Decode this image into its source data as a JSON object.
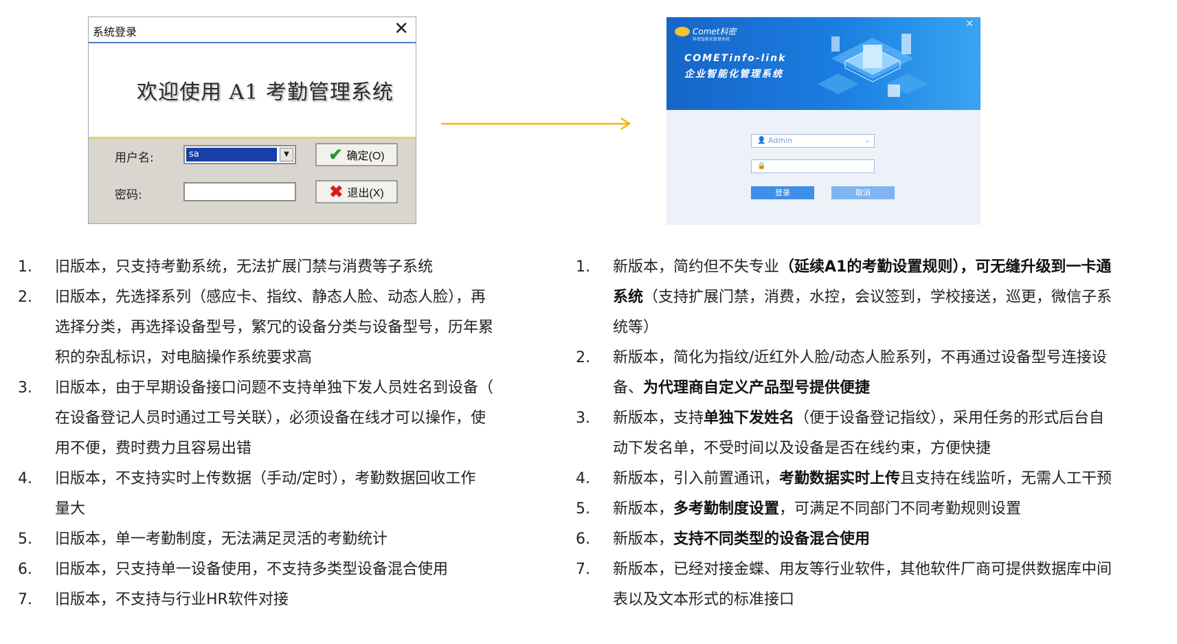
{
  "old_login": {
    "title": "系统登录",
    "close": "✕",
    "banner": "欢迎使用 A1 考勤管理系统",
    "username_label": "用户名:",
    "username_value": "sa",
    "password_label": "密码:",
    "ok_label": "确定(O)",
    "exit_label": "退出(X)"
  },
  "new_login": {
    "logo": "Comet科密",
    "logo_sub": "科密智能化管理系统",
    "brand": "COMETinfo-link",
    "subtitle": "企业智能化管理系统",
    "close": "✕",
    "username_value": "Admin",
    "login_label": "登录",
    "cancel_label": "取消"
  },
  "old_list": [
    {
      "num": "1.",
      "lines": [
        "旧版本，只支持考勤系统，无法扩展门禁与消费等子系统"
      ]
    },
    {
      "num": "2.",
      "lines": [
        "旧版本，先选择系列（感应卡、指纹、静态人脸、动态人脸），再",
        "选择分类，再选择设备型号，繁冗的设备分类与设备型号，历年累",
        "积的杂乱标识，对电脑操作系统要求高"
      ]
    },
    {
      "num": "3.",
      "lines": [
        "旧版本，由于早期设备接口问题不支持单独下发人员姓名到设备（",
        "在设备登记人员时通过工号关联），必须设备在线才可以操作，使",
        "用不便，费时费力且容易出错"
      ]
    },
    {
      "num": "4.",
      "lines": [
        "旧版本，不支持实时上传数据（手动/定时），考勤数据回收工作",
        "量大"
      ]
    },
    {
      "num": "5.",
      "lines": [
        "旧版本，单一考勤制度，无法满足灵活的考勤统计"
      ]
    },
    {
      "num": "6.",
      "lines": [
        "旧版本，只支持单一设备使用，不支持多类型设备混合使用"
      ]
    },
    {
      "num": "7.",
      "lines": [
        "旧版本，不支持与行业HR软件对接"
      ]
    }
  ],
  "new_list": [
    {
      "num": "1.",
      "parts": [
        {
          "t": "新版本，简约但不失专业",
          "b": false
        },
        {
          "t": "（延续A1的考勤设置规则），可无缝升级到一卡通",
          "b": true
        },
        {
          "t": "系统",
          "b": true,
          "br": true
        },
        {
          "t": "（支持扩展门禁，消费，水控，会议签到，学校接送，巡更，微信子系",
          "b": false
        },
        {
          "t": "统等）",
          "b": false,
          "br": true
        }
      ]
    },
    {
      "num": "2.",
      "parts": [
        {
          "t": "新版本，简化为指纹/近红外人脸/动态人脸系列，不再通过设备型号连接设",
          "b": false
        },
        {
          "t": "备、",
          "b": false,
          "br": true
        },
        {
          "t": "为代理商自定义产品型号提供便捷",
          "b": true
        }
      ]
    },
    {
      "num": "3.",
      "parts": [
        {
          "t": "新版本，支持",
          "b": false
        },
        {
          "t": "单独下发姓名",
          "b": true
        },
        {
          "t": "（便于设备登记指纹），采用任务的形式后台自",
          "b": false
        },
        {
          "t": "动下发名单，不受时间以及设备是否在线约束，方便快捷",
          "b": false,
          "br": true
        }
      ]
    },
    {
      "num": "4.",
      "parts": [
        {
          "t": "新版本，引入前置通讯，",
          "b": false
        },
        {
          "t": "考勤数据实时上传",
          "b": true
        },
        {
          "t": "且支持在线监听，无需人工干预",
          "b": false
        }
      ]
    },
    {
      "num": "5.",
      "parts": [
        {
          "t": "新版本，",
          "b": false
        },
        {
          "t": "多考勤制度设置",
          "b": true
        },
        {
          "t": "，可满足不同部门不同考勤规则设置",
          "b": false
        }
      ]
    },
    {
      "num": "6.",
      "parts": [
        {
          "t": "新版本，",
          "b": false
        },
        {
          "t": "支持不同类型的设备混合使用",
          "b": true
        }
      ]
    },
    {
      "num": "7.",
      "parts": [
        {
          "t": "新版本，已经对接金蝶、用友等行业软件，其他软件厂商可提供数据库中间",
          "b": false
        },
        {
          "t": "表以及文本形式的标准接口",
          "b": false,
          "br": true
        }
      ]
    }
  ],
  "colors": {
    "arrow": "#f2b705",
    "new_header": "#1b7ee0",
    "old_banner_accent": "#e9cf6a"
  }
}
